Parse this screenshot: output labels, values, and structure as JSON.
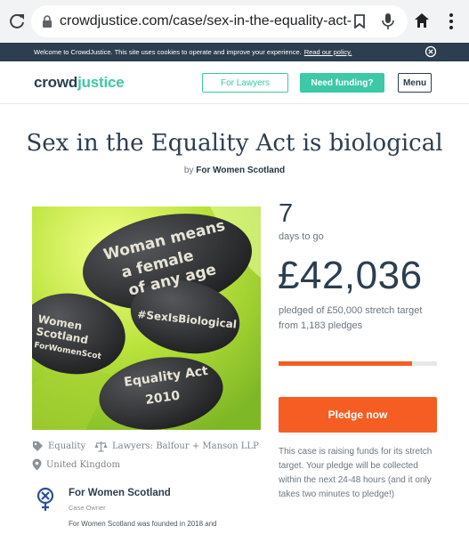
{
  "browser": {
    "url": "crowdjustice.com/case/sex-in-the-equality-act-is-biologi"
  },
  "cookie_bar": {
    "text": "Welcome to CrowdJustice. This site uses cookies to operate and improve your experience.",
    "link": "Read our policy."
  },
  "header": {
    "logo_part1": "crowd",
    "logo_part2": "justice",
    "lawyers_label": "For Lawyers",
    "funding_label": "Need funding?",
    "menu_label": "Menu"
  },
  "case": {
    "title": "Sex in the Equality Act is biological",
    "by_prefix": "by",
    "author": "For Women Scotland",
    "image_text": {
      "stone1": [
        "Woman means",
        "a female",
        "of any age"
      ],
      "stone2": "#SexIsBiological",
      "stone3": [
        "Women",
        "Scotland",
        "ForWomenScot"
      ],
      "stone4": [
        "Equality Act",
        "2010"
      ]
    }
  },
  "stats": {
    "days": "7",
    "days_label": "days to go",
    "amount": "£42,036",
    "pledged_text": "pledged of £50,000 stretch target from 1,183 pledges",
    "progress_fraction": 0.84
  },
  "pledge_button": "Pledge now",
  "info_text": "This case is raising funds for its stretch target. Your pledge will be collected within the next 24-48 hours (and it only takes two minutes to pledge!)",
  "tags": {
    "category": "Equality",
    "lawyers": "Lawyers: Balfour + Manson LLP",
    "location": "United Kingdom"
  },
  "owner": {
    "name": "For Women Scotland",
    "role": "Case Owner",
    "description": "For Women Scotland was founded in 2018 and"
  },
  "colors": {
    "brand_dark": "#2c3e4f",
    "brand_green": "#3dc8a7",
    "accent_orange": "#f55d22"
  }
}
